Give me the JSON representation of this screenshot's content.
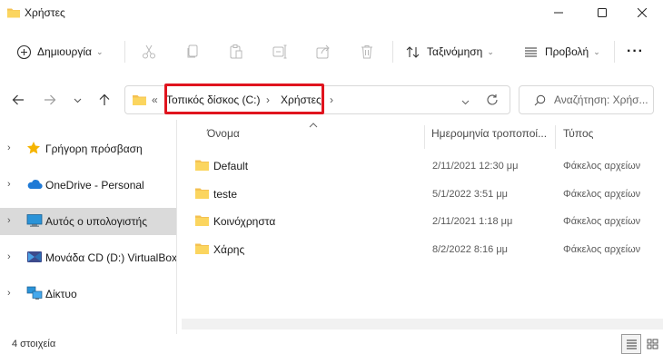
{
  "window": {
    "title": "Χρήστες",
    "folder_color": "#f4c152"
  },
  "commandbar": {
    "new_label": "Δημιουργία",
    "sort_label": "Ταξινόμηση",
    "view_label": "Προβολή",
    "more_label": "···"
  },
  "address": {
    "overflow": "«",
    "crumbs": [
      "Τοπικός δίσκος (C:)",
      "Χρήστες"
    ],
    "separator": "›",
    "highlight_color": "#e0141e"
  },
  "search": {
    "placeholder": "Αναζήτηση: Χρήσ..."
  },
  "sidebar": {
    "items": [
      {
        "label": "Γρήγορη πρόσβαση",
        "icon": "star-icon"
      },
      {
        "label": "OneDrive - Personal",
        "icon": "cloud-icon"
      },
      {
        "label": "Αυτός ο υπολογιστής",
        "icon": "monitor-icon"
      },
      {
        "label": "Μονάδα CD (D:) VirtualBox",
        "icon": "cd-drive-icon"
      },
      {
        "label": "Δίκτυο",
        "icon": "network-icon"
      }
    ],
    "selected_index": 2
  },
  "columns": {
    "name": "Όνομα",
    "date": "Ημερομηνία τροποποί...",
    "type": "Τύπος"
  },
  "files": [
    {
      "name": "Default",
      "date": "2/11/2021 12:30 μμ",
      "type": "Φάκελος αρχείων"
    },
    {
      "name": "teste",
      "date": "5/1/2022 3:51 μμ",
      "type": "Φάκελος αρχείων"
    },
    {
      "name": "Κοινόχρηστα",
      "date": "2/11/2021 1:18 μμ",
      "type": "Φάκελος αρχείων"
    },
    {
      "name": "Χάρης",
      "date": "8/2/2022 8:16 μμ",
      "type": "Φάκελος αρχείων"
    }
  ],
  "status": {
    "count_text": "4 στοιχεία"
  }
}
